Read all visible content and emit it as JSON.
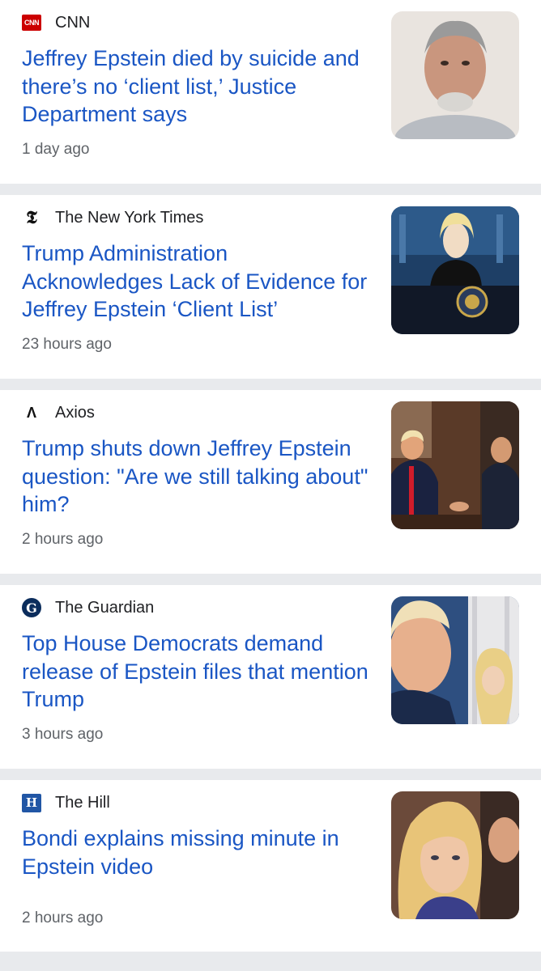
{
  "articles": [
    {
      "source": "CNN",
      "logo": "cnn-logo",
      "headline": "Jeffrey Epstein died by suicide and there’s no ‘client list,’ Justice Department says",
      "time": "1 day ago",
      "image": "man-portrait-photo"
    },
    {
      "source": "The New York Times",
      "logo": "nyt-logo",
      "headline": "Trump Administration Acknowledges Lack of Evidence for Jeffrey Epstein ‘Client List’",
      "time": "23 hours ago",
      "image": "press-briefing-podium-photo"
    },
    {
      "source": "Axios",
      "logo": "axios-logo",
      "headline": "Trump shuts down Jeffrey Epstein question: \"Are we still talking about\" him?",
      "time": "2 hours ago",
      "image": "cabinet-meeting-photo"
    },
    {
      "source": "The Guardian",
      "logo": "guardian-logo",
      "headline": "Top House Democrats demand release of Epstein files that mention Trump",
      "time": "3 hours ago",
      "image": "two-officials-photo"
    },
    {
      "source": "The Hill",
      "logo": "the-hill-logo",
      "headline": "Bondi explains missing minute in Epstein video",
      "time": "2 hours ago",
      "image": "woman-closeup-photo"
    }
  ],
  "logo_glyphs": {
    "cnn": "CNN",
    "nyt": "𝕿",
    "axios": "Λ",
    "guardian": "G",
    "hill": "H"
  },
  "colors": {
    "headline": "#1a56c4",
    "meta": "#5f6368",
    "separator": "#e8eaed"
  }
}
